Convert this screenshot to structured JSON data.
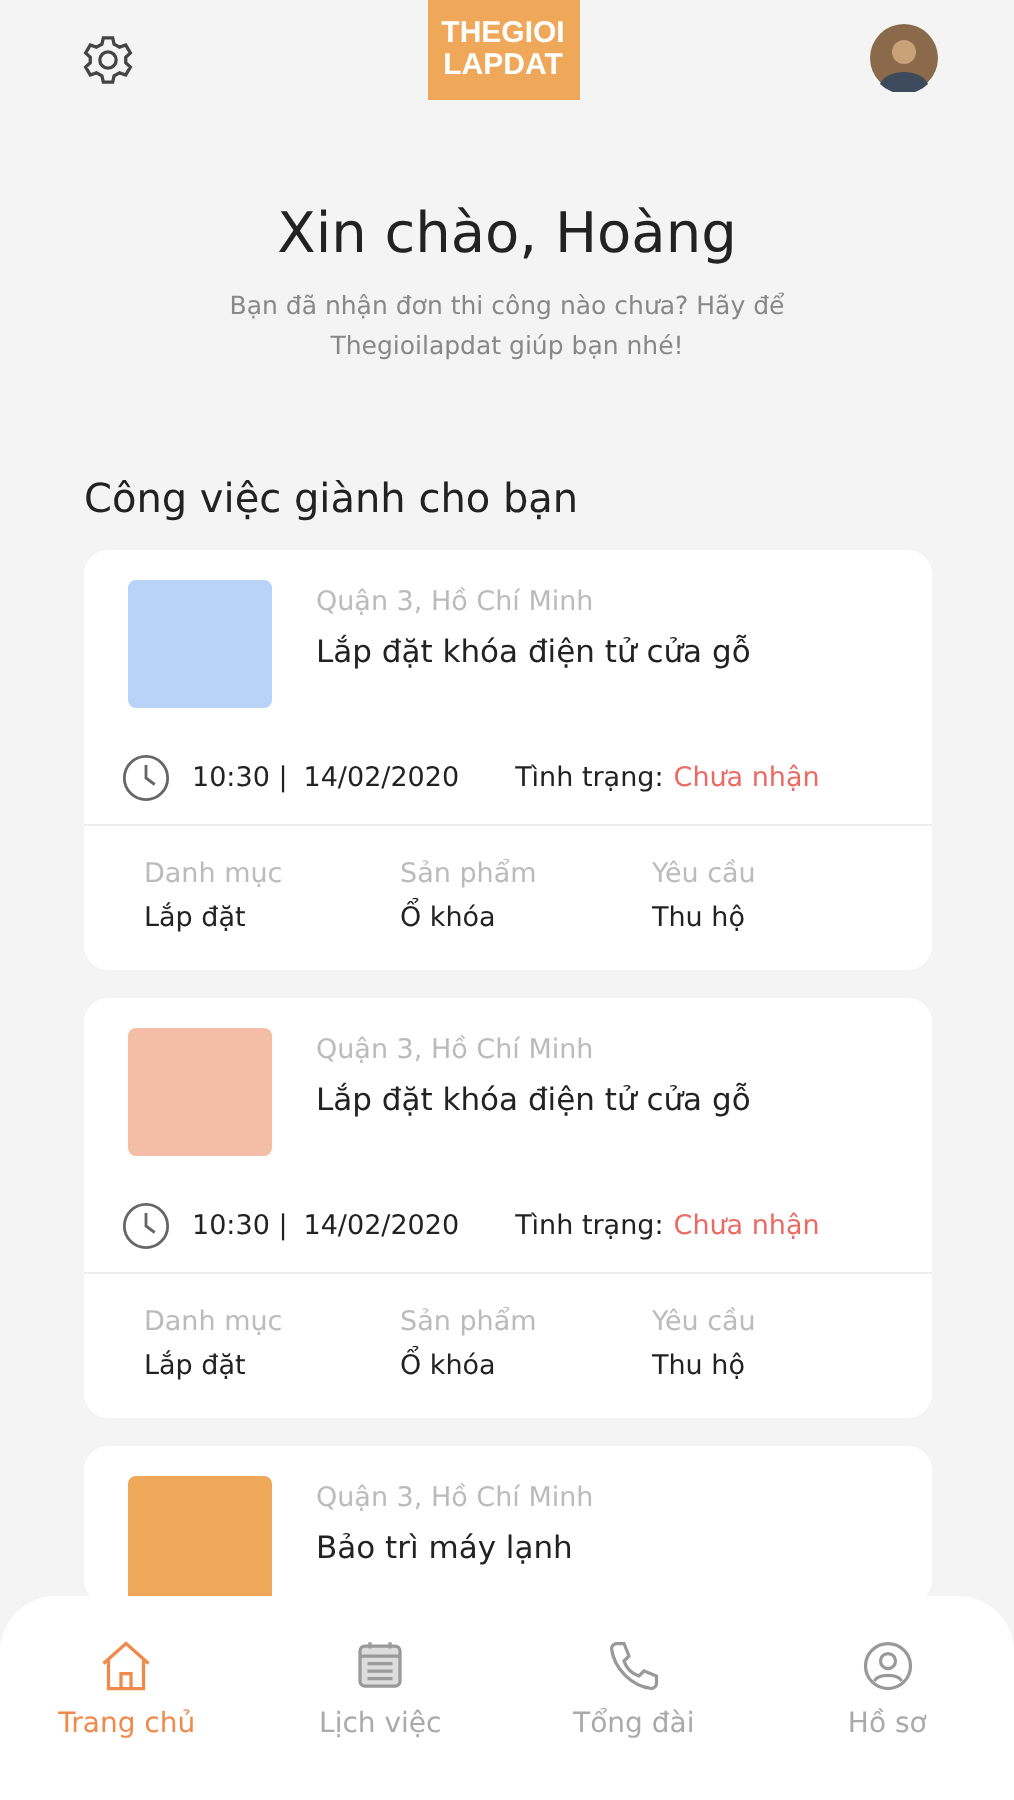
{
  "header": {
    "logo_lines": [
      "THEGIOI",
      "LAPDAT"
    ]
  },
  "greeting": {
    "title": "Xin chào, Hoàng",
    "subtitle": "Bạn đã nhận đơn thi công nào chưa? Hãy để Thegioilapdat giúp bạn nhé!"
  },
  "section_title": "Công việc giành cho bạn",
  "jobs": [
    {
      "location": "Quận 3, Hồ Chí Minh",
      "title": "Lắp đặt khóa điện tử cửa gỗ",
      "color": "#b7d3f7",
      "time": "10:30 |",
      "date": "14/02/2020",
      "status_label": "Tình trạng:",
      "status": "Chưa nhận",
      "details": [
        {
          "label": "Danh mục",
          "value": "Lắp đặt"
        },
        {
          "label": "Sản phẩm",
          "value": "Ổ khóa"
        },
        {
          "label": "Yêu cầu",
          "value": "Thu hộ"
        }
      ]
    },
    {
      "location": "Quận 3, Hồ Chí Minh",
      "title": "Lắp đặt khóa điện tử cửa gỗ",
      "color": "#f4bda6",
      "time": "10:30 |",
      "date": "14/02/2020",
      "status_label": "Tình trạng:",
      "status": "Chưa nhận",
      "details": [
        {
          "label": "Danh mục",
          "value": "Lắp đặt"
        },
        {
          "label": "Sản phẩm",
          "value": "Ổ khóa"
        },
        {
          "label": "Yêu cầu",
          "value": "Thu hộ"
        }
      ]
    },
    {
      "location": "Quận 3, Hồ Chí Minh",
      "title": "Bảo trì máy lạnh",
      "color": "#efa75a"
    }
  ],
  "nav": [
    {
      "kind": "home",
      "label": "Trang chủ",
      "selected": true
    },
    {
      "kind": "calendar",
      "label": "Lịch việc",
      "selected": false
    },
    {
      "kind": "phone",
      "label": "Tổng đài",
      "selected": false
    },
    {
      "kind": "profile",
      "label": "Hồ sơ",
      "selected": false
    }
  ]
}
